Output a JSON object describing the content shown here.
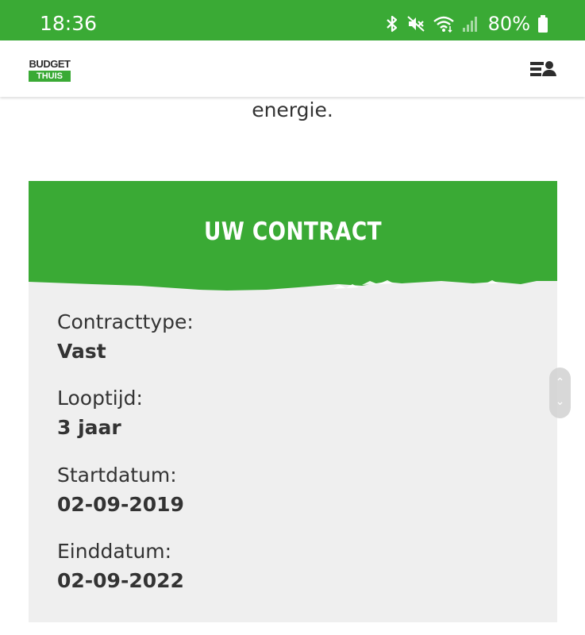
{
  "status_bar": {
    "time": "18:36",
    "battery": "80%"
  },
  "header": {
    "logo_top": "BUDGET",
    "logo_bottom": "THUIS"
  },
  "intro": {
    "text": "energie."
  },
  "contract": {
    "title": "UW CONTRACT",
    "fields": [
      {
        "label": "Contracttype:",
        "value": "Vast"
      },
      {
        "label": "Looptijd:",
        "value": "3 jaar"
      },
      {
        "label": "Startdatum:",
        "value": "02-09-2019"
      },
      {
        "label": "Einddatum:",
        "value": "02-09-2022"
      }
    ]
  },
  "colors": {
    "brand_green": "#3aaa35",
    "card_background": "#efefef",
    "text": "#333333"
  },
  "icons": [
    "bluetooth-icon",
    "mute-icon",
    "wifi-icon",
    "signal-icon",
    "battery-icon",
    "account-menu-icon"
  ]
}
